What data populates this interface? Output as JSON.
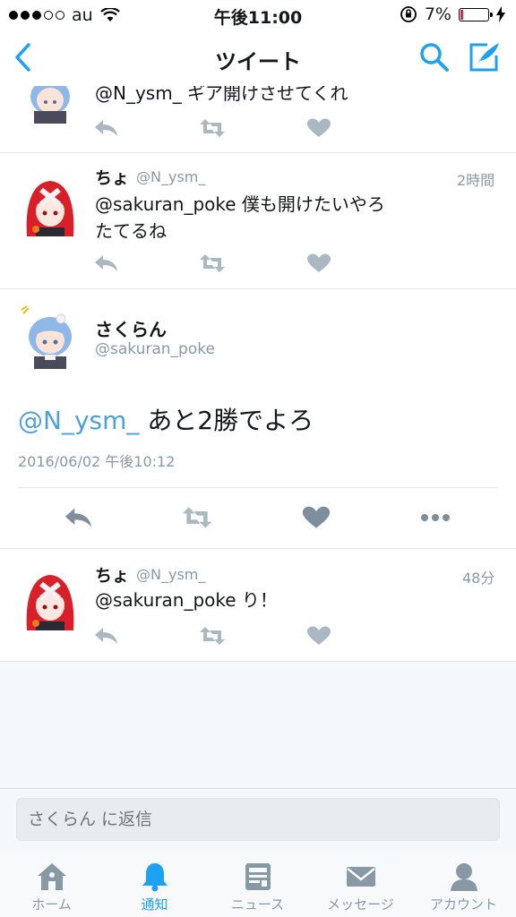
{
  "status_bar": {
    "carrier": "au",
    "time": "午後11:00",
    "battery": "7%",
    "signal_filled": 3,
    "signal_total": 5
  },
  "nav": {
    "title": "ツイート",
    "back_icon": "back-chevron-icon",
    "search_icon": "search-icon",
    "compose_icon": "compose-icon"
  },
  "tweets_above": [
    {
      "text": "@N_ysm_ ギア開けさせてくれ"
    },
    {
      "name": "ちょ",
      "handle": "@N_ysm_",
      "time": "2時間",
      "text_line1": "@sakuran_poke 僕も開けたいやろ",
      "text_line2": "たてるね"
    }
  ],
  "detail": {
    "name": "さくらん",
    "handle": "@sakuran_poke",
    "mention": "@N_ysm_",
    "text": " あと2勝でよろ",
    "date": "2016/06/02 午後10:12"
  },
  "tweets_below": [
    {
      "name": "ちょ",
      "handle": "@N_ysm_",
      "time": "48分",
      "text": "@sakuran_poke り！"
    }
  ],
  "reply": {
    "placeholder": "さくらん に返信"
  },
  "tabs": [
    {
      "label": "ホーム",
      "icon": "home-icon",
      "active": false
    },
    {
      "label": "通知",
      "icon": "bell-icon",
      "active": true
    },
    {
      "label": "ニュース",
      "icon": "news-icon",
      "active": false
    },
    {
      "label": "メッセージ",
      "icon": "envelope-icon",
      "active": false
    },
    {
      "label": "アカウント",
      "icon": "person-icon",
      "active": false
    }
  ],
  "colors": {
    "accent": "#1da1f2",
    "mention": "#4ea1d9",
    "muted": "#8899a6",
    "icon_gray": "#aab8c2",
    "battery_low": "#e0245e"
  }
}
